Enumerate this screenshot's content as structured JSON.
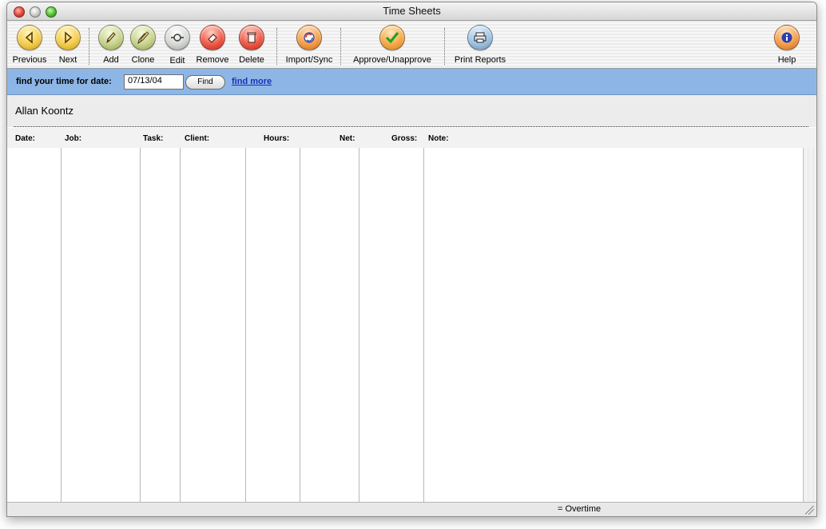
{
  "window": {
    "title": "Time Sheets"
  },
  "toolbar": {
    "previous": "Previous",
    "next": "Next",
    "add": "Add",
    "clone": "Clone",
    "edit": "Edit",
    "remove": "Remove",
    "delete": "Delete",
    "import_sync": "Import/Sync",
    "approve": "Approve/Unapprove",
    "print_reports": "Print Reports",
    "help": "Help"
  },
  "search": {
    "label": "find your time for date:",
    "date_value": "07/13/04",
    "find_button": "Find",
    "find_more": "find more"
  },
  "employee": {
    "name": "Allan Koontz"
  },
  "table": {
    "columns": [
      "Date:",
      "Job:",
      "Task:",
      "Client:",
      "Hours:",
      "Net:",
      "Gross:",
      "Note:"
    ],
    "rows": []
  },
  "status": {
    "overtime_legend": "= Overtime"
  },
  "colors": {
    "search_bar": "#8db6e6",
    "link": "#1a2fb8"
  }
}
